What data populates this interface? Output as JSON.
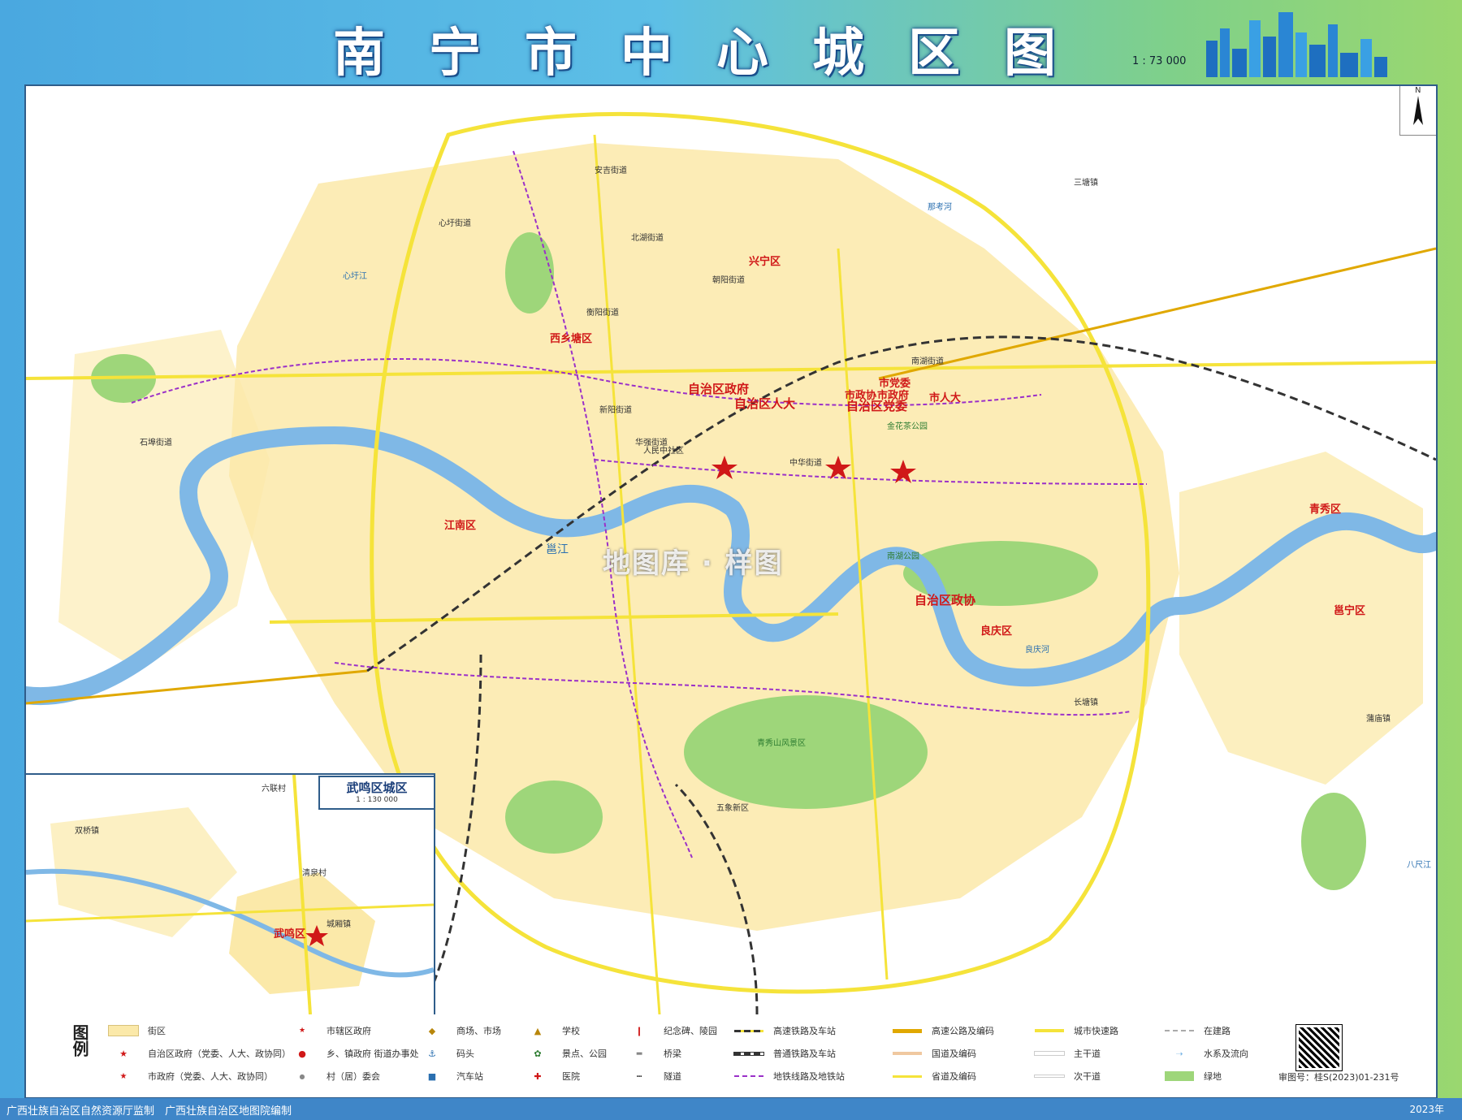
{
  "header": {
    "title": "南宁市中心城区图",
    "scale": "1 : 73 000"
  },
  "map": {
    "watermark": "地图库 · 样图",
    "north_label": "N",
    "district_labels": [
      "兴宁区",
      "西乡塘区",
      "青秀区",
      "江南区",
      "良庆区",
      "邕宁区"
    ],
    "gov_labels": [
      "自治区政府",
      "自治区人大",
      "自治区党委",
      "自治区政协",
      "市政府",
      "市政协",
      "市人大",
      "市党委"
    ],
    "place_labels": [
      "安吉街道",
      "北湖街道",
      "新阳街道",
      "华强街道",
      "衡阳街道",
      "人民中社区",
      "五象新区",
      "石埠街道",
      "心圩街道",
      "三塘镇",
      "长塘镇",
      "蒲庙镇",
      "南湖公园",
      "青秀山风景区",
      "金花茶公园",
      "朝阳街道",
      "南湖街道",
      "中华街道"
    ],
    "water_labels": [
      "邕江",
      "心圩江",
      "良庆河",
      "八尺江",
      "那考河"
    ]
  },
  "inset": {
    "title": "武鸣区城区",
    "scale": "1 : 130 000",
    "labels": [
      "武鸣区",
      "城厢镇",
      "六联村",
      "清泉村",
      "双桥镇"
    ]
  },
  "legend": {
    "heading": "图例",
    "items": [
      {
        "symbol": "area-yellow",
        "label": "街区"
      },
      {
        "symbol": "star-red",
        "label": "自治区政府（党委、人大、政协同）"
      },
      {
        "symbol": "star-red-small",
        "label": "市政府（党委、人大、政协同）"
      },
      {
        "symbol": "star-red-tiny",
        "label": "市辖区政府"
      },
      {
        "symbol": "dot-red",
        "label": "乡、镇政府 街道办事处"
      },
      {
        "symbol": "dot-gray",
        "label": "村（居）委会"
      },
      {
        "symbol": "shop-icon",
        "label": "商场、市场"
      },
      {
        "symbol": "dock-icon",
        "label": "码头"
      },
      {
        "symbol": "bus-icon",
        "label": "汽车站"
      },
      {
        "symbol": "school-icon",
        "label": "学校"
      },
      {
        "symbol": "park-icon",
        "label": "景点、公园"
      },
      {
        "symbol": "hospital-icon",
        "label": "医院"
      },
      {
        "symbol": "monument-icon",
        "label": "纪念碑、陵园"
      },
      {
        "symbol": "bridge-icon",
        "label": "桥梁"
      },
      {
        "symbol": "tunnel-icon",
        "label": "隧道"
      },
      {
        "symbol": "hsr-line",
        "label": "高速铁路及车站"
      },
      {
        "symbol": "rail-line",
        "label": "普通铁路及车站"
      },
      {
        "symbol": "metro-line",
        "label": "地铁线路及地铁站"
      },
      {
        "symbol": "expressway",
        "label": "高速公路及编码"
      },
      {
        "symbol": "national-road",
        "label": "国道及编码"
      },
      {
        "symbol": "provincial-road",
        "label": "省道及编码"
      },
      {
        "symbol": "urban-expressway",
        "label": "城市快速路"
      },
      {
        "symbol": "main-road",
        "label": "主干道"
      },
      {
        "symbol": "sub-road",
        "label": "次干道"
      },
      {
        "symbol": "under-construction",
        "label": "在建路"
      },
      {
        "symbol": "water",
        "label": "水系及流向"
      },
      {
        "symbol": "green",
        "label": "绿地"
      }
    ],
    "review_no": "审图号：桂S(2023)01-231号"
  },
  "footer": {
    "left": "广西壮族自治区自然资源厅监制　广西壮族自治区地图院编制",
    "right": "2023年"
  },
  "colors": {
    "block": "#fbe9a9",
    "road": "#fff36b",
    "river": "#7fb8e6",
    "green": "#9ed67a",
    "metro": "#9b30c8",
    "gov": "#d01818"
  }
}
